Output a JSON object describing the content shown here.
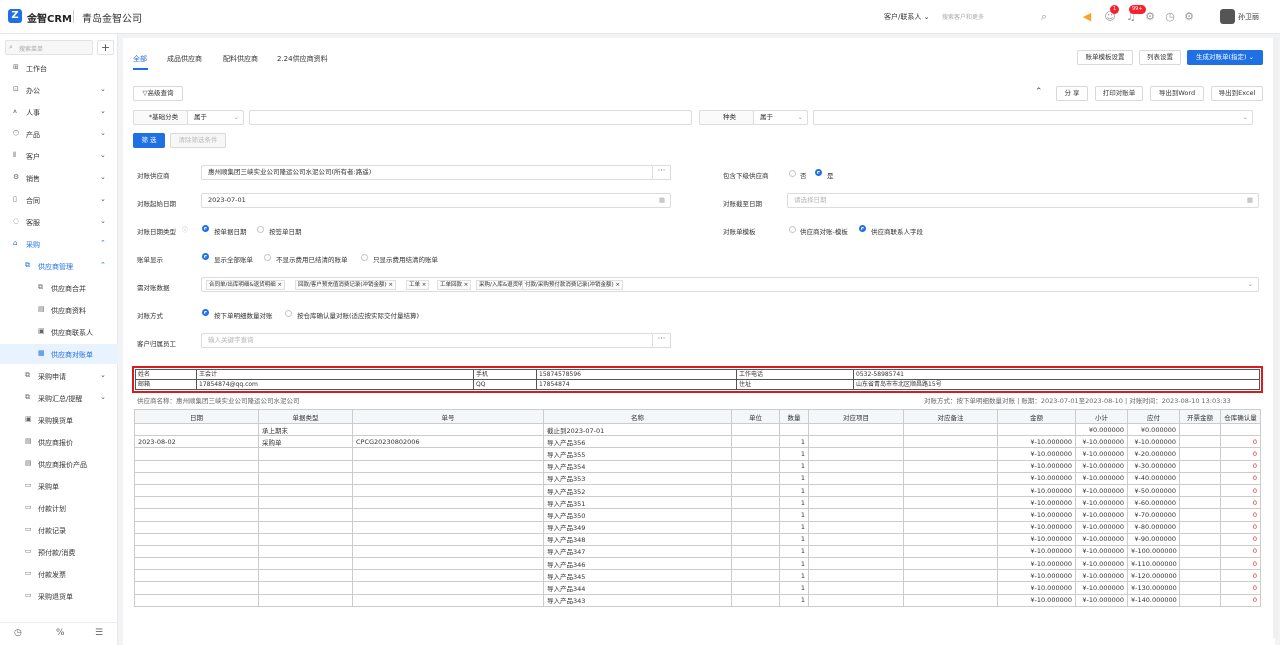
{
  "header": {
    "logo_mark": "Z",
    "brand": "金智CRM",
    "company": "青岛金智公司",
    "search_type": "客户/联系人",
    "search_placeholder": "搜索客户和更多",
    "badge_1": "1",
    "badge_2": "99+",
    "user": "孙卫丽"
  },
  "sidebar": {
    "search_placeholder": "搜索菜单",
    "add": "+",
    "items": [
      {
        "label": "工作台",
        "icon": "⊞",
        "level": 0,
        "chev": ""
      },
      {
        "label": "办公",
        "icon": "⊡",
        "level": 0,
        "chev": "⌄"
      },
      {
        "label": "人事",
        "icon": "⩚",
        "level": 0,
        "chev": "⌄"
      },
      {
        "label": "产品",
        "icon": "⬡",
        "level": 0,
        "chev": "⌄"
      },
      {
        "label": "客户",
        "icon": "⫴",
        "level": 0,
        "chev": "⌄"
      },
      {
        "label": "销售",
        "icon": "⚙",
        "level": 0,
        "chev": "⌄"
      },
      {
        "label": "合同",
        "icon": "▯",
        "level": 0,
        "chev": "⌄"
      },
      {
        "label": "客服",
        "icon": "◌",
        "level": 0,
        "chev": "⌄"
      },
      {
        "label": "采购",
        "icon": "⌂",
        "level": 0,
        "chev": "⌃",
        "blue": true
      },
      {
        "label": "供应商管理",
        "icon": "⧉",
        "level": 1,
        "chev": "⌃",
        "blue": true
      },
      {
        "label": "供应商合并",
        "icon": "⧉",
        "level": 2,
        "chev": ""
      },
      {
        "label": "供应商资料",
        "icon": "▤",
        "level": 2,
        "chev": ""
      },
      {
        "label": "供应商联系人",
        "icon": "▣",
        "level": 2,
        "chev": ""
      },
      {
        "label": "供应商对账单",
        "icon": "▦",
        "level": 2,
        "chev": "",
        "active": true
      },
      {
        "label": "采购申请",
        "icon": "⧉",
        "level": 1,
        "chev": "⌄"
      },
      {
        "label": "采购汇总/提醒",
        "icon": "⧉",
        "level": 1,
        "chev": "⌄"
      },
      {
        "label": "采购换货单",
        "icon": "▣",
        "level": 1,
        "chev": ""
      },
      {
        "label": "供应商报价",
        "icon": "▤",
        "level": 1,
        "chev": ""
      },
      {
        "label": "供应商报价产品",
        "icon": "▤",
        "level": 1,
        "chev": ""
      },
      {
        "label": "采购单",
        "icon": "▭",
        "level": 1,
        "chev": ""
      },
      {
        "label": "付款计划",
        "icon": "▭",
        "level": 1,
        "chev": ""
      },
      {
        "label": "付款记录",
        "icon": "▭",
        "level": 1,
        "chev": ""
      },
      {
        "label": "预付款/消费",
        "icon": "▭",
        "level": 1,
        "chev": ""
      },
      {
        "label": "付款发票",
        "icon": "▭",
        "level": 1,
        "chev": ""
      },
      {
        "label": "采购退货单",
        "icon": "▭",
        "level": 1,
        "chev": ""
      }
    ],
    "footer": [
      "◷",
      "%",
      "☰"
    ]
  },
  "tabs": [
    "全部",
    "成品供应商",
    "配料供应商",
    "2.24供应商资料"
  ],
  "top_buttons": {
    "template": "账单模板设置",
    "list": "列表设置",
    "generate": "生成对账单(指定)"
  },
  "filter": {
    "advanced": "高级查询",
    "share": "分 享",
    "print": "打印对账单",
    "export_word": "导出到Word",
    "export_excel": "导出到Excel",
    "cond1_field": "*基础分类",
    "cond1_op": "属于",
    "cond2_field": "种类",
    "cond2_op": "属于",
    "search_btn": "筛 选",
    "clear_btn": "清除筛选条件"
  },
  "form": {
    "supplier_label": "对账供应商",
    "supplier_value": "惠州顺集团三峡实业公司隆运公司水泥公司(所有者:路遥)",
    "include_sub_label": "包含下级供应商",
    "no": "否",
    "yes": "是",
    "start_label": "对账起始日期",
    "start_value": "2023-07-01",
    "end_label": "对账截至日期",
    "end_placeholder": "请选择日期",
    "datetype_label": "对账日期类型",
    "datetype_opt1": "按单据日期",
    "datetype_opt2": "按签单日期",
    "template_label": "对账单模板",
    "template_opt1": "供应商对账-模板",
    "template_opt2": "供应商联系人字段",
    "show_label": "账单显示",
    "show_opt1": "显示全部账单",
    "show_opt2": "不显示费用已结清的账单",
    "show_opt3": "只显示费用结清的账单",
    "data_label": "需对账数据",
    "data_tags": [
      "合同单/出库明细&退货明细",
      "回款/客户预充值消费记录(冲销金额)",
      "工单",
      "工单回款",
      "采购/入库&退货明细",
      "付款/采购预付款消费记录(冲销金额)"
    ],
    "method_label": "对账方式",
    "method_opt1": "按下单明细数量对账",
    "method_opt2": "按仓库确认量对账(适应按实际交付量结算)",
    "staff_label": "客户归属员工",
    "staff_placeholder": "输入关键字查询"
  },
  "contact": {
    "name_label": "姓名",
    "name": "王会计",
    "mobile_label": "手机",
    "mobile": "15874578596",
    "phone_label": "工作电话",
    "phone": "0532-58985741",
    "email_label": "邮箱",
    "email": "17854874@qq.com",
    "qq_label": "QQ",
    "qq": "17854874",
    "addr_label": "住址",
    "addr": "山东省青岛市市北区顺昌路15号"
  },
  "summary": {
    "left": "供应商名称：惠州顺集团三峡实业公司隆运公司水泥公司",
    "right": "对账方式：按下单明细数量对账  |  账期：2023-07-01至2023-08-10  |  对账时间：2023-08-10 13:03:33"
  },
  "table": {
    "headers": [
      "日期",
      "单据类型",
      "单号",
      "名称",
      "单位",
      "数量",
      "对应项目",
      "对应备注",
      "金额",
      "小计",
      "应付",
      "开票金额",
      "仓库确认量"
    ],
    "rows": [
      [
        "",
        "承上期末",
        "",
        "截止到2023-07-01",
        "",
        "",
        "",
        "",
        "",
        "¥0.000000",
        "¥0.000000",
        "",
        ""
      ],
      [
        "2023-08-02",
        "采购单",
        "CPCG20230802006",
        "导入产品356",
        "",
        "1",
        "",
        "",
        "¥-10.000000",
        "¥-10.000000",
        "¥-10.000000",
        "",
        "0"
      ],
      [
        "",
        "",
        "",
        "导入产品355",
        "",
        "1",
        "",
        "",
        "¥-10.000000",
        "¥-10.000000",
        "¥-20.000000",
        "",
        "0"
      ],
      [
        "",
        "",
        "",
        "导入产品354",
        "",
        "1",
        "",
        "",
        "¥-10.000000",
        "¥-10.000000",
        "¥-30.000000",
        "",
        "0"
      ],
      [
        "",
        "",
        "",
        "导入产品353",
        "",
        "1",
        "",
        "",
        "¥-10.000000",
        "¥-10.000000",
        "¥-40.000000",
        "",
        "0"
      ],
      [
        "",
        "",
        "",
        "导入产品352",
        "",
        "1",
        "",
        "",
        "¥-10.000000",
        "¥-10.000000",
        "¥-50.000000",
        "",
        "0"
      ],
      [
        "",
        "",
        "",
        "导入产品351",
        "",
        "1",
        "",
        "",
        "¥-10.000000",
        "¥-10.000000",
        "¥-60.000000",
        "",
        "0"
      ],
      [
        "",
        "",
        "",
        "导入产品350",
        "",
        "1",
        "",
        "",
        "¥-10.000000",
        "¥-10.000000",
        "¥-70.000000",
        "",
        "0"
      ],
      [
        "",
        "",
        "",
        "导入产品349",
        "",
        "1",
        "",
        "",
        "¥-10.000000",
        "¥-10.000000",
        "¥-80.000000",
        "",
        "0"
      ],
      [
        "",
        "",
        "",
        "导入产品348",
        "",
        "1",
        "",
        "",
        "¥-10.000000",
        "¥-10.000000",
        "¥-90.000000",
        "",
        "0"
      ],
      [
        "",
        "",
        "",
        "导入产品347",
        "",
        "1",
        "",
        "",
        "¥-10.000000",
        "¥-10.000000",
        "¥-100.000000",
        "",
        "0"
      ],
      [
        "",
        "",
        "",
        "导入产品346",
        "",
        "1",
        "",
        "",
        "¥-10.000000",
        "¥-10.000000",
        "¥-110.000000",
        "",
        "0"
      ],
      [
        "",
        "",
        "",
        "导入产品345",
        "",
        "1",
        "",
        "",
        "¥-10.000000",
        "¥-10.000000",
        "¥-120.000000",
        "",
        "0"
      ],
      [
        "",
        "",
        "",
        "导入产品344",
        "",
        "1",
        "",
        "",
        "¥-10.000000",
        "¥-10.000000",
        "¥-130.000000",
        "",
        "0"
      ],
      [
        "",
        "",
        "",
        "导入产品343",
        "",
        "1",
        "",
        "",
        "¥-10.000000",
        "¥-10.000000",
        "¥-140.000000",
        "",
        "0"
      ]
    ]
  },
  "colors": {
    "accent": "#1f6fe5",
    "highlight": "#d91c1c",
    "zero": "#e02020"
  }
}
